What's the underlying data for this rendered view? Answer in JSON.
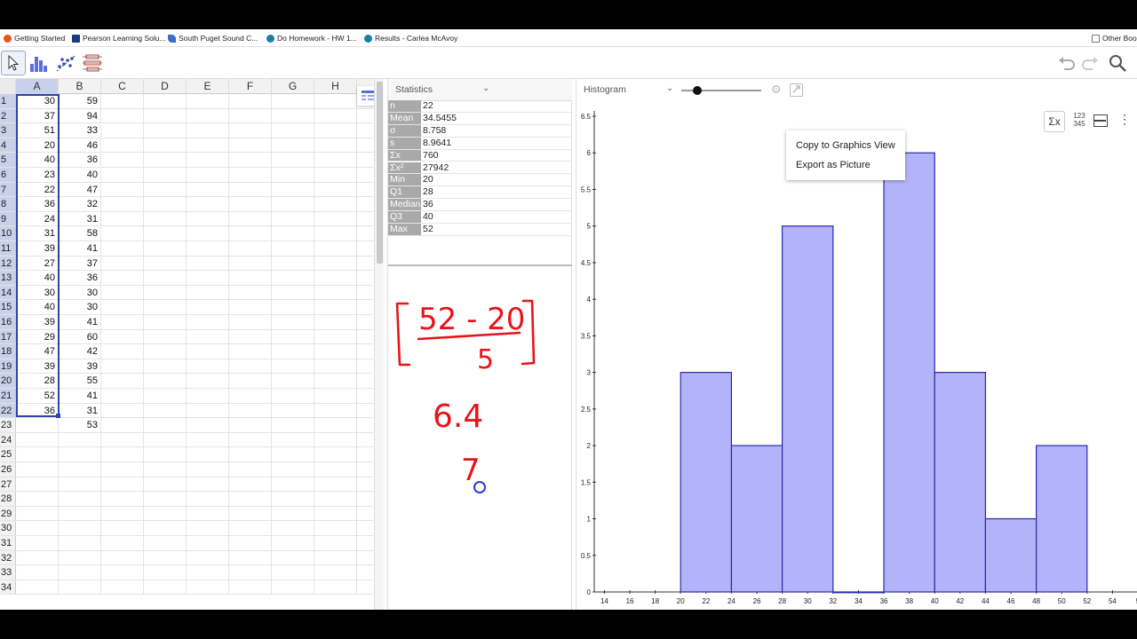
{
  "bookmarks": [
    {
      "label": "Getting Started",
      "color": "#e8541f"
    },
    {
      "label": "Pearson Learning Solu...",
      "color": "#1e3a7a"
    },
    {
      "label": "South Puget Sound C...",
      "color": "#3b6fc4"
    },
    {
      "label": "Do Homework - HW 1...",
      "color": "#1b7fa8"
    },
    {
      "label": "Results - Carlea McAvoy",
      "color": "#1b7fa8"
    },
    {
      "label": "Other Book",
      "color": "#777777"
    }
  ],
  "sheet": {
    "columns": [
      "A",
      "B",
      "C",
      "D",
      "E",
      "F",
      "G",
      "H"
    ],
    "rows": [
      {
        "n": "1",
        "a": "30",
        "b": "59"
      },
      {
        "n": "2",
        "a": "37",
        "b": "94"
      },
      {
        "n": "3",
        "a": "51",
        "b": "33"
      },
      {
        "n": "4",
        "a": "20",
        "b": "46"
      },
      {
        "n": "5",
        "a": "40",
        "b": "36"
      },
      {
        "n": "6",
        "a": "23",
        "b": "40"
      },
      {
        "n": "7",
        "a": "22",
        "b": "47"
      },
      {
        "n": "8",
        "a": "36",
        "b": "32"
      },
      {
        "n": "9",
        "a": "24",
        "b": "31"
      },
      {
        "n": "10",
        "a": "31",
        "b": "58"
      },
      {
        "n": "11",
        "a": "39",
        "b": "41"
      },
      {
        "n": "12",
        "a": "27",
        "b": "37"
      },
      {
        "n": "13",
        "a": "40",
        "b": "36"
      },
      {
        "n": "14",
        "a": "30",
        "b": "30"
      },
      {
        "n": "15",
        "a": "40",
        "b": "30"
      },
      {
        "n": "16",
        "a": "39",
        "b": "41"
      },
      {
        "n": "17",
        "a": "29",
        "b": "60"
      },
      {
        "n": "18",
        "a": "47",
        "b": "42"
      },
      {
        "n": "19",
        "a": "39",
        "b": "39"
      },
      {
        "n": "20",
        "a": "28",
        "b": "55"
      },
      {
        "n": "21",
        "a": "52",
        "b": "41"
      },
      {
        "n": "22",
        "a": "36",
        "b": "31"
      },
      {
        "n": "23",
        "a": "",
        "b": "53"
      },
      {
        "n": "24",
        "a": "",
        "b": ""
      },
      {
        "n": "25",
        "a": "",
        "b": ""
      },
      {
        "n": "26",
        "a": "",
        "b": ""
      },
      {
        "n": "27",
        "a": "",
        "b": ""
      },
      {
        "n": "28",
        "a": "",
        "b": ""
      },
      {
        "n": "29",
        "a": "",
        "b": ""
      },
      {
        "n": "30",
        "a": "",
        "b": ""
      },
      {
        "n": "31",
        "a": "",
        "b": ""
      },
      {
        "n": "32",
        "a": "",
        "b": ""
      },
      {
        "n": "33",
        "a": "",
        "b": ""
      },
      {
        "n": "34",
        "a": "",
        "b": ""
      }
    ]
  },
  "stats": {
    "dropdown_label": "Statistics",
    "rows": [
      {
        "label": "n",
        "value": "22"
      },
      {
        "label": "Mean",
        "value": "34.5455"
      },
      {
        "label": "σ",
        "value": "8.758"
      },
      {
        "label": "s",
        "value": "8.9641"
      },
      {
        "label": "Σx",
        "value": "760"
      },
      {
        "label": "Σx²",
        "value": "27942"
      },
      {
        "label": "Min",
        "value": "20"
      },
      {
        "label": "Q1",
        "value": "28"
      },
      {
        "label": "Median",
        "value": "36"
      },
      {
        "label": "Q3",
        "value": "40"
      },
      {
        "label": "Max",
        "value": "52"
      }
    ]
  },
  "handwriting": {
    "numerator": "52 - 20",
    "denominator": "5",
    "result": "6.4",
    "rounded": "7",
    "color": "#e8141a"
  },
  "hist_panel": {
    "dropdown_label": "Histogram",
    "slider_value": 0.2,
    "right_icons": {
      "sigma": "Σx",
      "numbers_top": "123",
      "numbers_bottom": "345"
    },
    "menu": [
      "Copy to Graphics View",
      "Export as Picture"
    ]
  },
  "chart_data": {
    "type": "bar",
    "bins": [
      {
        "start": 20,
        "end": 24,
        "value": 3
      },
      {
        "start": 24,
        "end": 28,
        "value": 2
      },
      {
        "start": 28,
        "end": 32,
        "value": 5
      },
      {
        "start": 32,
        "end": 36,
        "value": 0
      },
      {
        "start": 36,
        "end": 40,
        "value": 6
      },
      {
        "start": 40,
        "end": 44,
        "value": 3
      },
      {
        "start": 44,
        "end": 48,
        "value": 1
      },
      {
        "start": 48,
        "end": 52,
        "value": 2
      }
    ],
    "xticks": [
      "14",
      "16",
      "18",
      "20",
      "22",
      "24",
      "26",
      "28",
      "30",
      "32",
      "34",
      "36",
      "38",
      "40",
      "42",
      "44",
      "46",
      "48",
      "50",
      "52",
      "54",
      "5"
    ],
    "yticks": [
      "0",
      "0.5",
      "1",
      "1.5",
      "2",
      "2.5",
      "3",
      "3.5",
      "4",
      "4.5",
      "5",
      "5.5",
      "6",
      "6.5"
    ],
    "xlim": [
      13.2,
      56
    ],
    "ylim": [
      0,
      6.5
    ],
    "bar_color": "#b3b3fa",
    "edge_color": "#2a2aa8"
  }
}
